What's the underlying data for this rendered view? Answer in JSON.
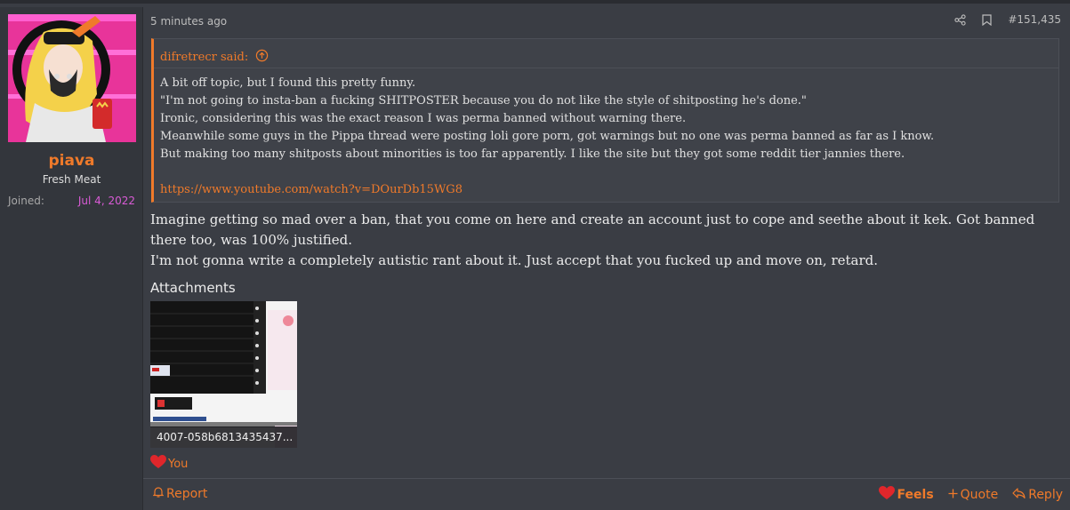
{
  "user": {
    "name": "piava",
    "title": "Fresh Meat",
    "joined_label": "Joined:",
    "joined_date": "Jul 4, 2022"
  },
  "post": {
    "timestamp": "5 minutes ago",
    "number": "#151,435",
    "quote": {
      "author": "difretrecr said:",
      "lines": [
        "A bit off topic, but I found this pretty funny.",
        "\"I'm not going to insta-ban a fucking SHITPOSTER because you do not like the style of shitposting he's done.\"",
        "Ironic, considering this was the exact reason I was perma banned without warning there.",
        "Meanwhile some guys in the Pippa thread were posting loli gore porn, got warnings but no one was perma banned as far as I know.",
        "But making too many shitposts about minorities is too far apparently. I like the site but they got some reddit tier jannies there."
      ],
      "link": "https://www.youtube.com/watch?v=DOurDb15WG8"
    },
    "body": [
      "Imagine getting so mad over a ban, that you come on here and create an account just to cope and seethe about it kek. Got banned there too, was 100% justified.",
      "I'm not gonna write a completely autistic rant about it. Just accept that you fucked up and move on, retard."
    ],
    "attachments_title": "Attachments",
    "attachment_name": "4007-058b6813435437...",
    "reaction_user": "You"
  },
  "footer": {
    "report": "Report",
    "feels": "Feels",
    "quote": "Quote",
    "reply": "Reply"
  },
  "icons": {
    "share": "share-icon",
    "bookmark": "bookmark-icon",
    "quote_up": "arrow-up-circle-icon",
    "heart": "heart-icon",
    "bell": "bell-icon",
    "plus": "plus-icon",
    "reply": "reply-icon"
  },
  "colors": {
    "accent": "#f07a2a",
    "joined_date": "#d95bd6",
    "background": "#3a3d44"
  }
}
